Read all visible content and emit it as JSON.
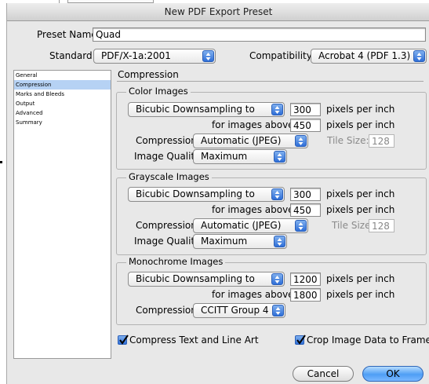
{
  "dialog": {
    "title": "New PDF Export Preset",
    "preset_name_label": "Preset Name:",
    "preset_name_value": "Quad",
    "standard_label": "Standard:",
    "standard_value": "PDF/X-1a:2001",
    "compatibility_label": "Compatibility:",
    "compatibility_value": "Acrobat 4 (PDF 1.3)"
  },
  "sidebar": {
    "items": [
      {
        "label": "General",
        "selected": false
      },
      {
        "label": "Compression",
        "selected": true
      },
      {
        "label": "Marks and Bleeds",
        "selected": false
      },
      {
        "label": "Output",
        "selected": false
      },
      {
        "label": "Advanced",
        "selected": false
      },
      {
        "label": "Summary",
        "selected": false
      }
    ]
  },
  "panel": {
    "title": "Compression",
    "color": {
      "title": "Color Images",
      "sampling": "Bicubic Downsampling to",
      "ppi_value": "300",
      "ppi_unit": "pixels per inch",
      "above_label": "for images above:",
      "above_value": "450",
      "above_unit": "pixels per inch",
      "compression_label": "Compression:",
      "compression_value": "Automatic (JPEG)",
      "tile_label": "Tile Size:",
      "tile_value": "128",
      "quality_label": "Image Quality:",
      "quality_value": "Maximum"
    },
    "grayscale": {
      "title": "Grayscale Images",
      "sampling": "Bicubic Downsampling to",
      "ppi_value": "300",
      "ppi_unit": "pixels per inch",
      "above_label": "for images above:",
      "above_value": "450",
      "above_unit": "pixels per inch",
      "compression_label": "Compression:",
      "compression_value": "Automatic (JPEG)",
      "tile_label": "Tile Size:",
      "tile_value": "128",
      "quality_label": "Image Quality:",
      "quality_value": "Maximum"
    },
    "mono": {
      "title": "Monochrome Images",
      "sampling": "Bicubic Downsampling to",
      "ppi_value": "1200",
      "ppi_unit": "pixels per inch",
      "above_label": "for images above:",
      "above_value": "1800",
      "above_unit": "pixels per inch",
      "compression_label": "Compression:",
      "compression_value": "CCITT Group 4"
    },
    "compress_text": {
      "label": "Compress Text and Line Art",
      "checked": true
    },
    "crop_frames": {
      "label": "Crop Image Data to Frames",
      "checked": true
    }
  },
  "buttons": {
    "cancel": "Cancel",
    "ok": "OK"
  }
}
